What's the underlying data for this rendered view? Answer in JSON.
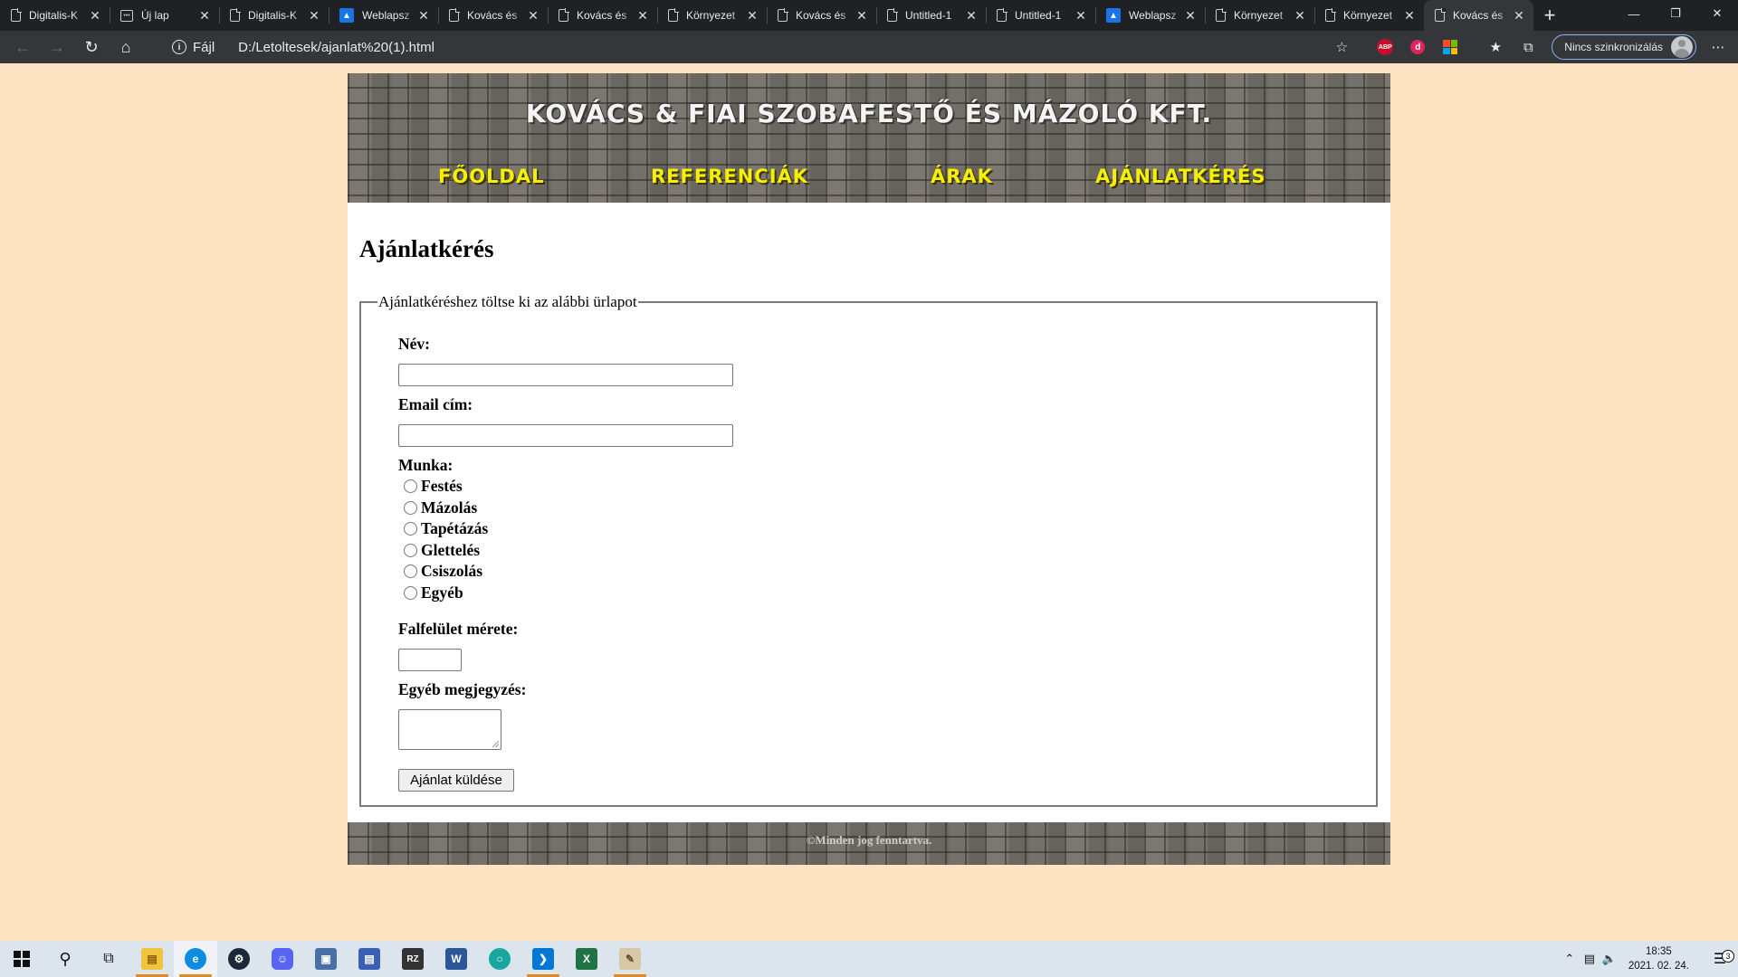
{
  "browser": {
    "tabs": [
      {
        "title": "Digitalis-K",
        "icon": "page-icon",
        "active": false
      },
      {
        "title": "Új lap",
        "icon": "newtab-icon",
        "active": false
      },
      {
        "title": "Digitalis-K",
        "icon": "page-icon",
        "active": false
      },
      {
        "title": "Weblapsz",
        "icon": "site-icon",
        "active": false
      },
      {
        "title": "Kovács és",
        "icon": "page-icon",
        "active": false
      },
      {
        "title": "Kovács és",
        "icon": "page-icon",
        "active": false
      },
      {
        "title": "Környezet",
        "icon": "page-icon",
        "active": false
      },
      {
        "title": "Kovács és",
        "icon": "page-icon",
        "active": false
      },
      {
        "title": "Untitled-1",
        "icon": "page-icon",
        "active": false
      },
      {
        "title": "Untitled-1",
        "icon": "page-icon",
        "active": false
      },
      {
        "title": "Weblapsz",
        "icon": "site-icon",
        "active": false
      },
      {
        "title": "Környezet",
        "icon": "page-icon",
        "active": false
      },
      {
        "title": "Környezet",
        "icon": "page-icon",
        "active": false
      },
      {
        "title": "Kovács és",
        "icon": "page-icon",
        "active": true
      }
    ],
    "scheme_label": "Fájl",
    "url": "D:/Letoltesek/ajanlat%20(1).html",
    "sync_label": "Nincs szinkronizálás",
    "ext_abp_label": "ABP"
  },
  "page": {
    "site_title": "Kovács & Fiai Szobafestő és Mázoló Kft.",
    "menu": [
      "Főoldal",
      "Referenciák",
      "Árak",
      "Ajánlatkérés"
    ],
    "heading": "Ajánlatkérés",
    "legend": "Ajánlatkéréshez töltse ki az alábbi ürlapot",
    "name_label": "Név:",
    "email_label": "Email cím:",
    "work_label": "Munka:",
    "work_options": [
      "Festés",
      "Mázolás",
      "Tapétázás",
      "Glettelés",
      "Csiszolás",
      "Egyéb"
    ],
    "area_label": "Falfelület mérete:",
    "note_label": "Egyéb megjegyzés:",
    "submit_label": "Ajánlat küldése",
    "footer": "©Minden jog fenntartva."
  },
  "taskbar": {
    "time": "18:35",
    "date": "2021. 02. 24.",
    "notification_count": "3"
  },
  "colors": {
    "page_background": "#ffe4c4",
    "menu_text": "#f6f000",
    "title_text": "#f4f4f4"
  }
}
